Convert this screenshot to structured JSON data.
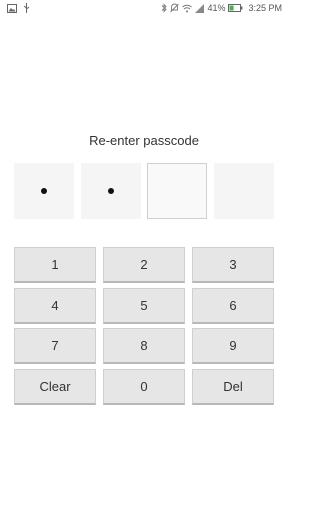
{
  "status_bar": {
    "left_icons": [
      "image-icon",
      "usb-icon"
    ],
    "right_icons": [
      "bluetooth-icon",
      "mute-icon",
      "wifi-icon",
      "signal-icon"
    ],
    "battery_percent": "41%",
    "time": "3:25 PM",
    "battery_level": 0.41
  },
  "title": "Re-enter passcode",
  "passcode": {
    "length": 4,
    "entered": 2,
    "active_index": 2
  },
  "keypad": {
    "keys": [
      "1",
      "2",
      "3",
      "4",
      "5",
      "6",
      "7",
      "8",
      "9",
      "Clear",
      "0",
      "Del"
    ]
  }
}
